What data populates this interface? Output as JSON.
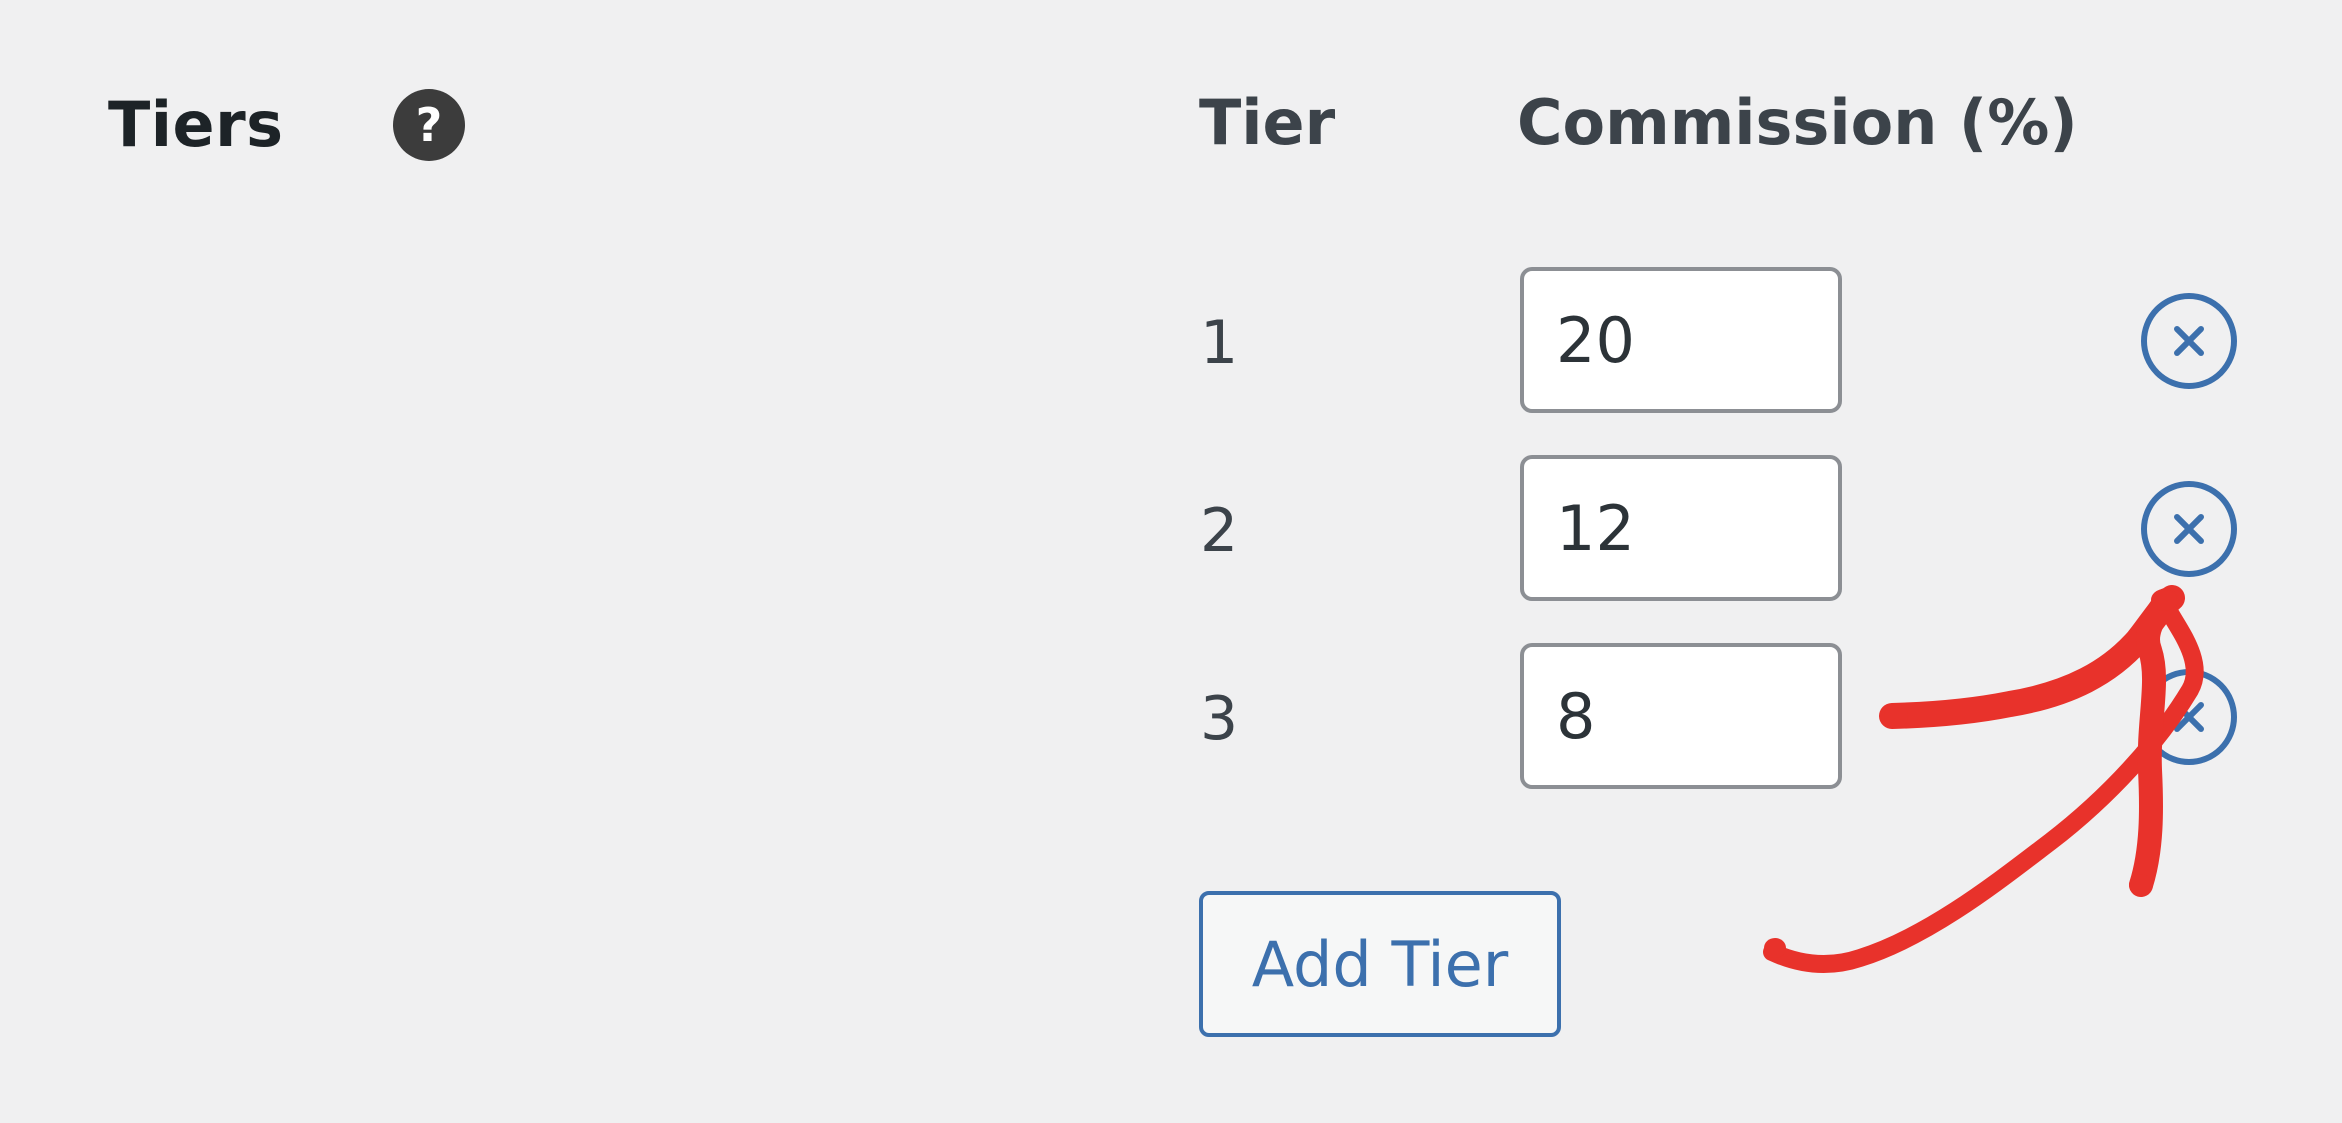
{
  "section": {
    "title": "Tiers",
    "help_icon": "question-mark-icon",
    "help_glyph": "?"
  },
  "table": {
    "headers": {
      "tier": "Tier",
      "commission": "Commission (%)"
    },
    "rows": [
      {
        "tier": "1",
        "commission": "20",
        "remove_icon": "close-circle-icon"
      },
      {
        "tier": "2",
        "commission": "12",
        "remove_icon": "close-circle-icon"
      },
      {
        "tier": "3",
        "commission": "8",
        "remove_icon": "close-circle-icon"
      }
    ]
  },
  "actions": {
    "add_tier_label": "Add Tier"
  },
  "annotation": {
    "type": "hand-drawn-arrow",
    "color": "#e8322b"
  },
  "colors": {
    "background": "#f0f0f1",
    "accent": "#3c70ad",
    "text": "#3c434a",
    "input_border": "#8c8f94"
  }
}
